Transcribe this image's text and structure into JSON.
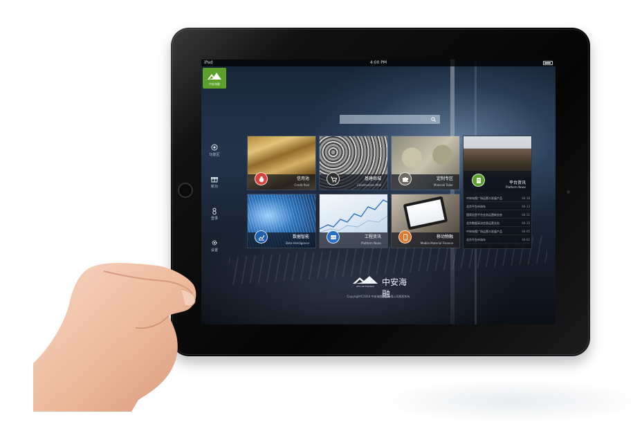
{
  "status_bar": {
    "device": "iPad",
    "time": "4:00 PM"
  },
  "logo": {
    "text": "中安海融"
  },
  "search": {
    "placeholder": ""
  },
  "nav": [
    {
      "label": "功能区",
      "icon": "target-icon"
    },
    {
      "label": "新功",
      "icon": "gift-icon"
    },
    {
      "label": "登录",
      "icon": "user-icon"
    },
    {
      "label": "设置",
      "icon": "gear-icon"
    }
  ],
  "tiles": [
    {
      "title": "信用池",
      "subtitle": "Credit Pool",
      "icon": "coin-bag-icon",
      "photo": "gold-cards"
    },
    {
      "title": "基建商城",
      "subtitle": "Construction Mall",
      "icon": "cart-icon",
      "photo": "steel-pipes"
    },
    {
      "title": "定制专区",
      "subtitle": "Material Tailor",
      "icon": "puzzle-icon",
      "photo": "puzzle"
    },
    {
      "title": "数据智能",
      "subtitle": "Data Intelligence",
      "icon": "chart-icon",
      "photo": "data-light"
    },
    {
      "title": "工程资讯",
      "subtitle": "Platform News",
      "icon": "news-icon",
      "photo": "stock-chart"
    },
    {
      "title": "移动物融",
      "subtitle": "Mobile Material Finance",
      "icon": "phone-icon",
      "photo": "tablet-hands"
    }
  ],
  "news_panel": {
    "title": "平台资讯",
    "subtitle": "Platform News",
    "icon": "document-icon",
    "items": [
      {
        "text": "中央电视广场运营与发展产品",
        "date": "04-18"
      },
      {
        "text": "北京平台市场年",
        "date": "04-13"
      },
      {
        "text": "国家信息平台业务运营新业态",
        "date": "04-11"
      },
      {
        "text": "北京数据采访信息运营业务",
        "date": "04-10"
      },
      {
        "text": "中央电视广场运营与发展产品",
        "date": "04-05"
      },
      {
        "text": "北京平台市场年",
        "date": "04-02"
      }
    ]
  },
  "brand": {
    "name": "中安海融",
    "sub": "ZHO AN FINANCE"
  },
  "copyright": "Copyright©2014 中安海融集团有限公司版权所有"
}
